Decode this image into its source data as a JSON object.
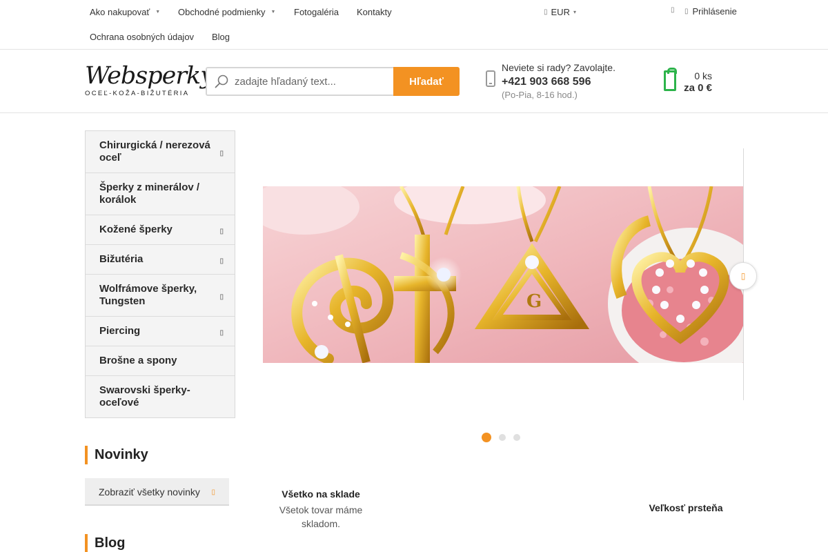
{
  "topnav": {
    "items": [
      "Ako nakupovať",
      "Obchodné podmienky",
      "Fotogaléria",
      "Kontakty",
      "Ochrana osobných údajov",
      "Blog"
    ],
    "currency": "EUR",
    "login": "Prihlásenie"
  },
  "logo": {
    "name": "Websperky",
    "tagline": "OCEĽ-KOŽA-BIŽUTÉRIA"
  },
  "search": {
    "placeholder": "zadajte hľadaný text...",
    "button": "Hľadať"
  },
  "contact": {
    "question": "Neviete si rady? Zavolajte.",
    "phone": "+421 903 668 596",
    "hours": "(Po-Pia, 8-16 hod.)"
  },
  "cart": {
    "quantity": "0 ks",
    "total": "za 0 €"
  },
  "categories": [
    "Chirurgická / nerezová oceľ",
    "Šperky z minerálov / korálok",
    "Kožené šperky",
    "Bižutéria",
    "Wolfrámove šperky, Tungsten",
    "Piercing",
    "Brošne a spony",
    "Swarovski šperky-oceľové"
  ],
  "news": {
    "title": "Novinky",
    "show_all": "Zobraziť všetky novinky"
  },
  "blog": {
    "title": "Blog"
  },
  "carousel": {
    "active_slide": 1,
    "slide_count": 3
  },
  "benefits": [
    {
      "title": "Všetko na sklade",
      "text": "Všetok tovar máme skladom."
    },
    {
      "title": "Veľkosť prsteňa",
      "text": ""
    }
  ],
  "colors": {
    "accent": "#f39222",
    "cart": "#2cb34a"
  }
}
